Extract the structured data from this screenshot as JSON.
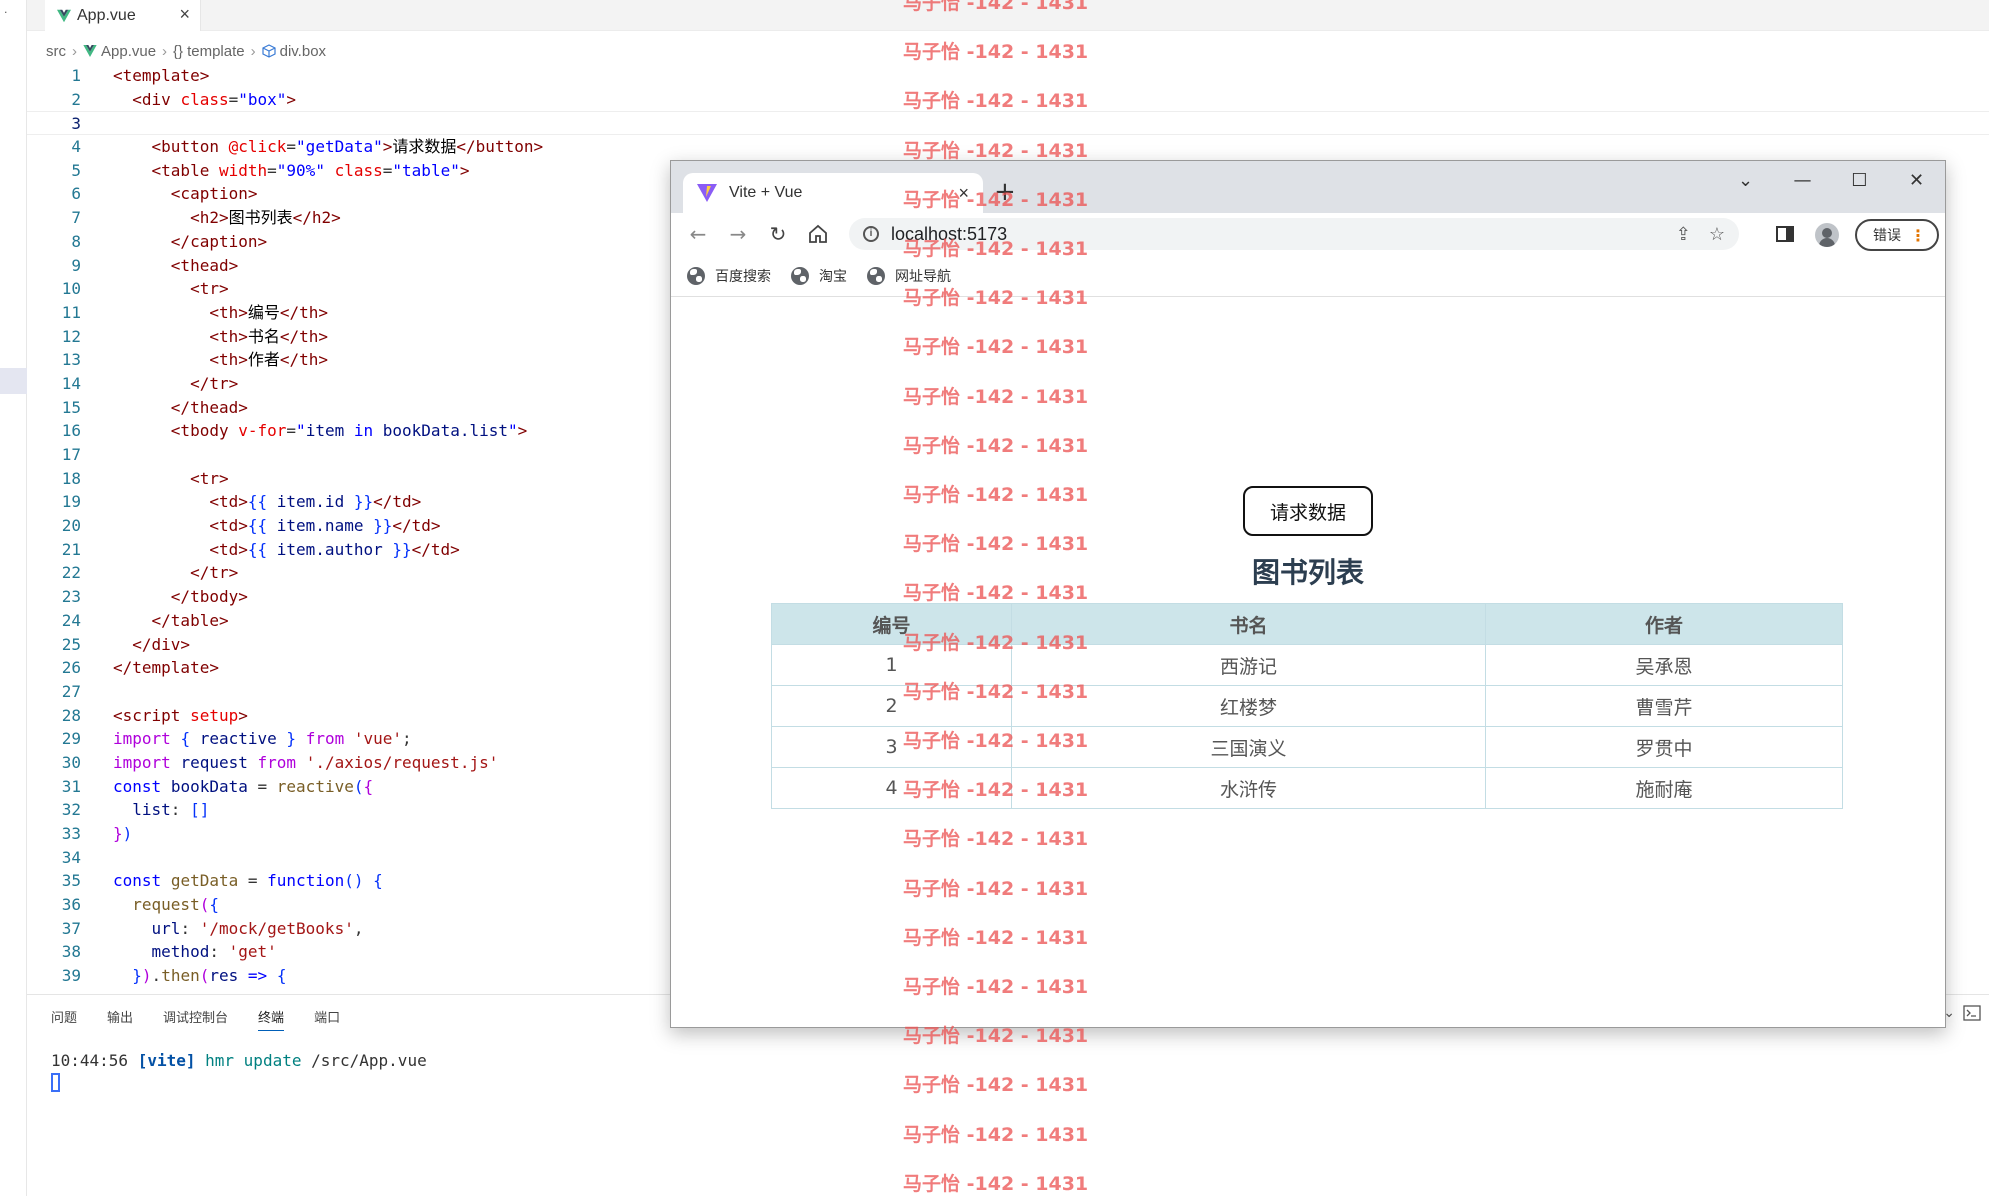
{
  "editor": {
    "tab": {
      "label": "App.vue",
      "close": "×"
    },
    "breadcrumb": [
      {
        "icon": "folder",
        "label": "src"
      },
      {
        "icon": "vue-logo",
        "label": "App.vue"
      },
      {
        "icon": "braces",
        "label": "template",
        "prefix": "{}"
      },
      {
        "icon": "cube",
        "label": "div.box"
      }
    ],
    "activity_dot": "·",
    "panel": {
      "tabs": [
        "问题",
        "输出",
        "调试控制台",
        "终端",
        "端口"
      ],
      "active_tab": "终端",
      "terminal": {
        "time": "10:44:56",
        "tag": "[vite]",
        "cmd": "hmr update",
        "path": "/src/App.vue"
      },
      "icons": [
        "chevron-down-icon",
        "terminal-icon"
      ]
    },
    "line_numbers": [
      "1",
      "2",
      "3",
      "4",
      "5",
      "6",
      "7",
      "8",
      "9",
      "10",
      "11",
      "12",
      "13",
      "14",
      "15",
      "16",
      "17",
      "18",
      "19",
      "20",
      "21",
      "22",
      "23",
      "24",
      "25",
      "26",
      "27",
      "28",
      "29",
      "30",
      "31",
      "32",
      "33",
      "34",
      "35",
      "36",
      "37",
      "38",
      "39"
    ],
    "current_line": 3
  },
  "browser": {
    "tab_title": "Vite + Vue",
    "tab_close": "×",
    "new_tab": "+",
    "window_controls": {
      "minimize": "—",
      "maximize": "☐",
      "close": "✕",
      "dropdown": "⌄"
    },
    "url": "localhost:5173",
    "error_button": "错误",
    "bookmarks": [
      "百度搜索",
      "淘宝",
      "网址导航"
    ],
    "page": {
      "button": "请求数据",
      "caption": "图书列表",
      "table": {
        "headers": [
          "编号",
          "书名",
          "作者"
        ],
        "rows": [
          [
            "1",
            "西游记",
            "吴承恩"
          ],
          [
            "2",
            "红楼梦",
            "曹雪芹"
          ],
          [
            "3",
            "三国演义",
            "罗贯中"
          ],
          [
            "4",
            "水浒传",
            "施耐庵"
          ]
        ]
      }
    }
  },
  "watermark": {
    "text": "马子怡 -142 - 1431",
    "count": 25
  },
  "colors": {
    "tag": "#800000",
    "attr": "#e50000",
    "string": "#0000ff",
    "keyword": "#0000ff",
    "control": "#af00db",
    "variable": "#001080",
    "table_header_bg": "#cde5ea",
    "watermark": "#eb5050"
  }
}
